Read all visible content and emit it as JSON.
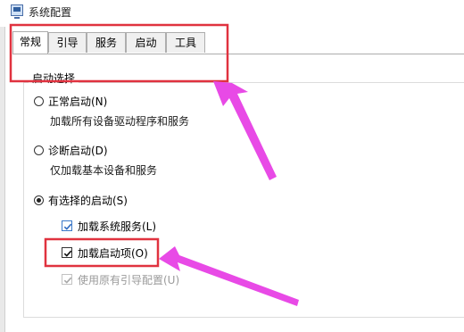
{
  "window": {
    "title": "系统配置"
  },
  "tabs": [
    {
      "label": "常规",
      "active": true
    },
    {
      "label": "引导",
      "active": false
    },
    {
      "label": "服务",
      "active": false
    },
    {
      "label": "启动",
      "active": false
    },
    {
      "label": "工具",
      "active": false
    }
  ],
  "startup": {
    "group_label": "启动选择",
    "normal": {
      "label": "正常启动(N)",
      "desc": "加载所有设备驱动程序和服务",
      "selected": false
    },
    "diagnostic": {
      "label": "诊断启动(D)",
      "desc": "仅加载基本设备和服务",
      "selected": false
    },
    "selective": {
      "label": "有选择的启动(S)",
      "selected": true,
      "options": [
        {
          "label": "加载系统服务(L)",
          "checked": true,
          "enabled": true
        },
        {
          "label": "加载启动项(O)",
          "checked": true,
          "enabled": true
        },
        {
          "label": "使用原有引导配置(U)",
          "checked": true,
          "enabled": false
        }
      ]
    }
  },
  "colors": {
    "highlight_box": "#e0323f",
    "arrow": "#e84ae6",
    "checkbox_blue": "#3b79c9",
    "disabled_text": "#9a9a9a"
  }
}
